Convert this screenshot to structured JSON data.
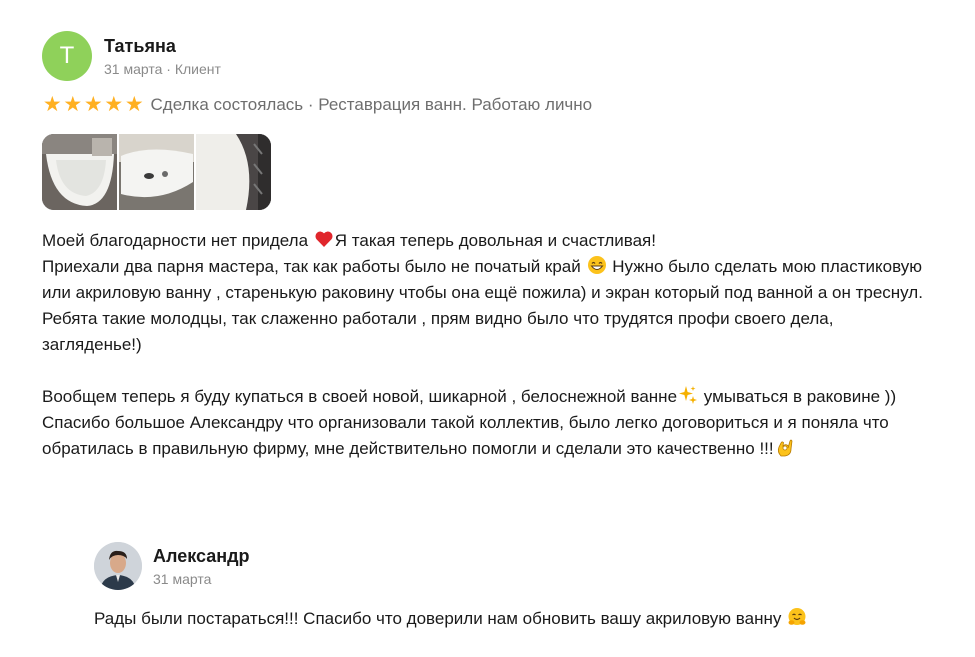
{
  "review": {
    "author": {
      "initial": "Т",
      "name": "Татьяна",
      "meta": "31 марта · Клиент",
      "avatar_color": "#8fd15a"
    },
    "rating": 5,
    "star_color": "#ffb021",
    "deal": "Сделка состоялась · Реставрация ванн. Работаю лично",
    "photos": [
      "bathtub-photo",
      "sink-photo",
      "bathtub-side-photo"
    ],
    "paragraphs": {
      "l1a": "Моей благодарности нет придела ",
      "l1b": "Я такая теперь довольная и счастливая!",
      "p2a": "Приехали два парня мастера, так как работы было не початый край ",
      "p2b": " Нужно было сделать мою пластиковую или акриловую ванну , старенькую раковину чтобы она ещё пожила) и экран который под ванной а он треснул.",
      "p3": "Ребята такие молодцы, так слаженно работали , прям видно было что трудятся профи своего дела, загляденье!)",
      "p4a": "Вообщем теперь я буду купаться в своей новой, шикарной , белоснежной ванне",
      "p4b": " умываться в раковине )) Спасибо большое Александру что организовали такой коллектив, было легко договориться и я поняла что обратилась в правильную фирму, мне действительно помогли и сделали это качественно !!!"
    }
  },
  "reply": {
    "name": "Александр",
    "date": "31 марта",
    "text": "Рады были постараться!!! Спасибо что доверили нам обновить вашу акриловую ванну "
  }
}
